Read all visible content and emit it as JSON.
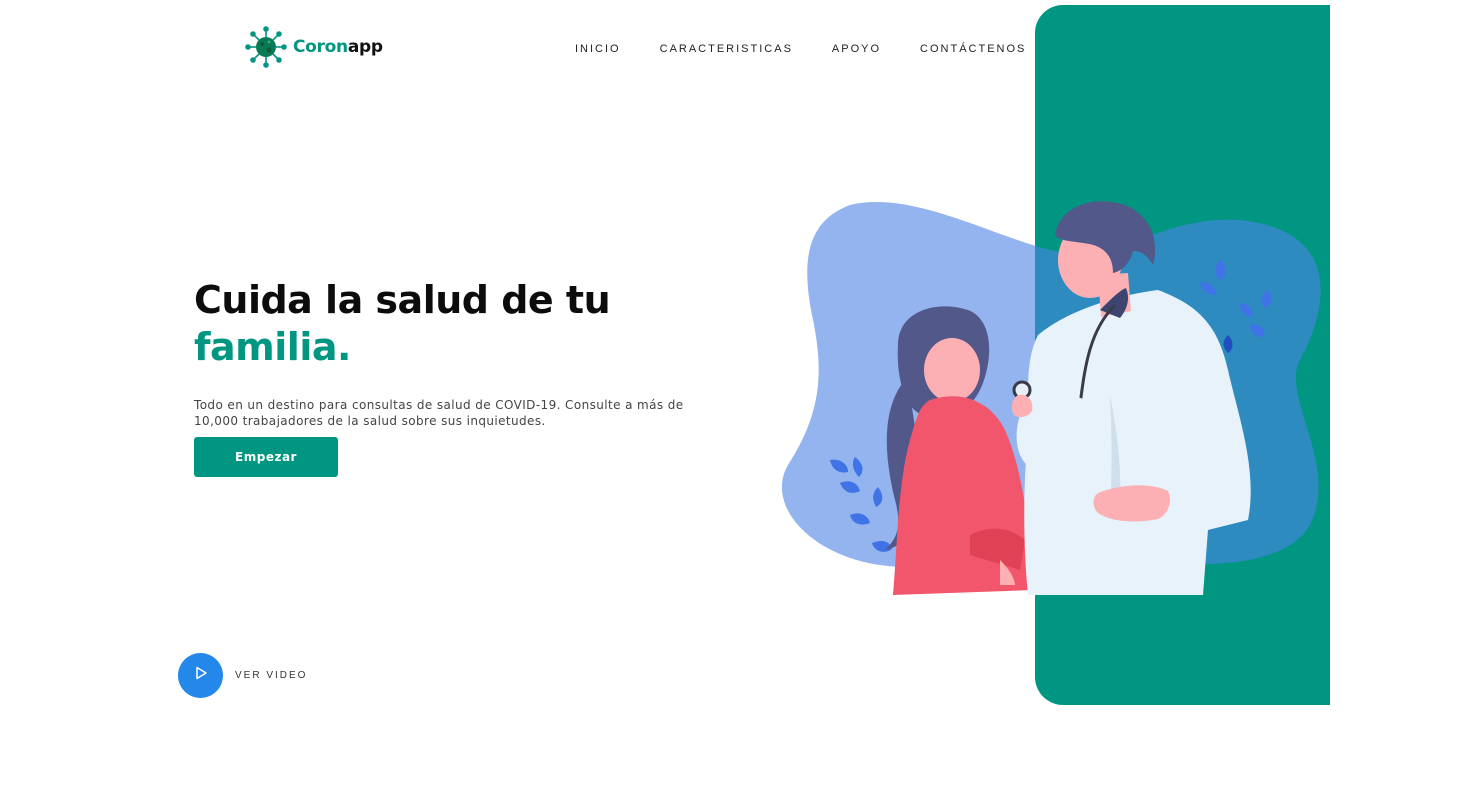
{
  "brand": {
    "name_part1": "Coron",
    "name_part2": "app",
    "icon": "virus-icon"
  },
  "nav": {
    "items": [
      {
        "label": "INICIO"
      },
      {
        "label": "CARACTERISTICAS"
      },
      {
        "label": "APOYO"
      },
      {
        "label": "CONTÁCTENOS"
      }
    ]
  },
  "hero": {
    "title_line1": "Cuida la salud de tu",
    "title_line2": "familia.",
    "description": "Todo en un destino para consultas de salud de COVID-19. Consulte a más de 10,000 trabajadores de la salud sobre sus inquietudes.",
    "cta_label": "Empezar"
  },
  "video": {
    "label": "VER VIDEO",
    "icon": "play-icon"
  },
  "colors": {
    "accent": "#009681",
    "play": "#2488ea",
    "blob_light": "#93b4ef",
    "blob_dark": "#2d8bbf"
  }
}
